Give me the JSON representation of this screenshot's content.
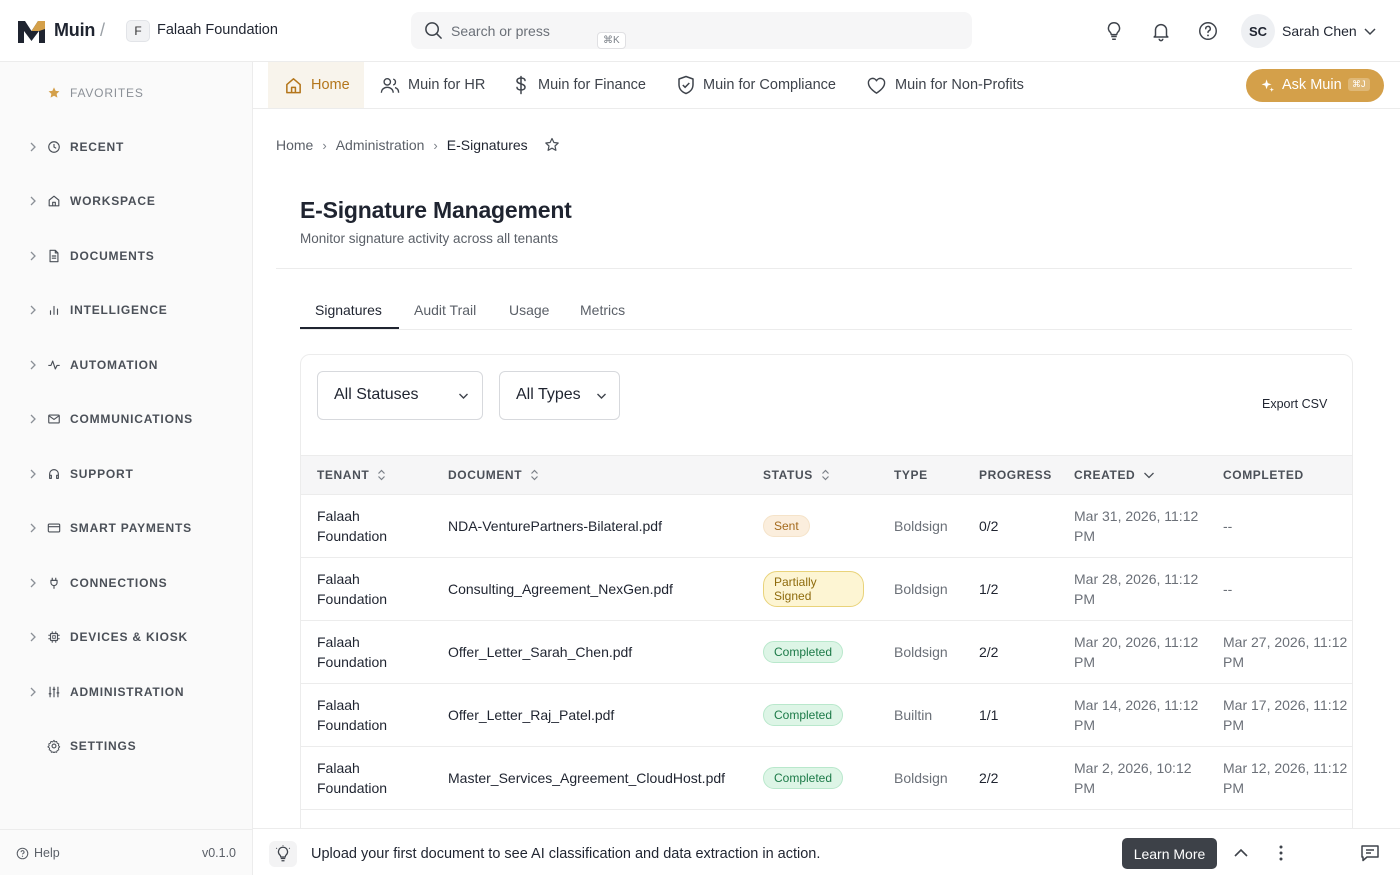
{
  "header": {
    "brand": "Muin",
    "separator": "/",
    "tenant_initial": "F",
    "tenant_name": "Falaah Foundation",
    "search_placeholder": "Search or press",
    "search_shortcut": "⌘K",
    "user_initials": "SC",
    "user_name": "Sarah Chen"
  },
  "sidebar": {
    "items": [
      {
        "label": "FAVORITES",
        "icon": "star-icon"
      },
      {
        "label": "RECENT",
        "icon": "clock-icon"
      },
      {
        "label": "WORKSPACE",
        "icon": "home-icon"
      },
      {
        "label": "DOCUMENTS",
        "icon": "document-icon"
      },
      {
        "label": "INTELLIGENCE",
        "icon": "chart-bars-icon"
      },
      {
        "label": "AUTOMATION",
        "icon": "activity-icon"
      },
      {
        "label": "COMMUNICATIONS",
        "icon": "mail-icon"
      },
      {
        "label": "SUPPORT",
        "icon": "headset-icon"
      },
      {
        "label": "SMART PAYMENTS",
        "icon": "card-icon"
      },
      {
        "label": "CONNECTIONS",
        "icon": "plug-icon"
      },
      {
        "label": "DEVICES & KIOSK",
        "icon": "chip-icon"
      },
      {
        "label": "ADMINISTRATION",
        "icon": "sliders-icon"
      },
      {
        "label": "SETTINGS",
        "icon": "gear-icon"
      }
    ],
    "help": "Help",
    "version": "v0.1.0"
  },
  "nav": {
    "tabs": [
      {
        "label": "Home",
        "icon": "home-icon"
      },
      {
        "label": "Muin for HR",
        "icon": "users-icon"
      },
      {
        "label": "Muin for Finance",
        "icon": "dollar-icon"
      },
      {
        "label": "Muin for Compliance",
        "icon": "shield-check-icon"
      },
      {
        "label": "Muin for Non-Profits",
        "icon": "heart-icon"
      }
    ],
    "ask_label": "Ask Muin",
    "ask_shortcut": "⌘J"
  },
  "breadcrumb": [
    "Home",
    "Administration",
    "E-Signatures"
  ],
  "page": {
    "title": "E-Signature Management",
    "subtitle": "Monitor signature activity across all tenants"
  },
  "tabs": [
    "Signatures",
    "Audit Trail",
    "Usage",
    "Metrics"
  ],
  "filters": {
    "status": "All Statuses",
    "type": "All Types",
    "export": "Export CSV"
  },
  "table": {
    "columns": [
      "TENANT",
      "DOCUMENT",
      "STATUS",
      "TYPE",
      "PROGRESS",
      "CREATED",
      "COMPLETED"
    ],
    "rows": [
      {
        "tenant": "Falaah Foundation",
        "document": "NDA-VenturePartners-Bilateral.pdf",
        "status": "Sent",
        "type": "Boldsign",
        "progress": "0/2",
        "created": "Mar 31, 2026, 11:12 PM",
        "completed": "--"
      },
      {
        "tenant": "Falaah Foundation",
        "document": "Consulting_Agreement_NexGen.pdf",
        "status": "Partially Signed",
        "type": "Boldsign",
        "progress": "1/2",
        "created": "Mar 28, 2026, 11:12 PM",
        "completed": "--"
      },
      {
        "tenant": "Falaah Foundation",
        "document": "Offer_Letter_Sarah_Chen.pdf",
        "status": "Completed",
        "type": "Boldsign",
        "progress": "2/2",
        "created": "Mar 20, 2026, 11:12 PM",
        "completed": "Mar 27, 2026, 11:12 PM"
      },
      {
        "tenant": "Falaah Foundation",
        "document": "Offer_Letter_Raj_Patel.pdf",
        "status": "Completed",
        "type": "Builtin",
        "progress": "1/1",
        "created": "Mar 14, 2026, 11:12 PM",
        "completed": "Mar 17, 2026, 11:12 PM"
      },
      {
        "tenant": "Falaah Foundation",
        "document": "Master_Services_Agreement_CloudHost.pdf",
        "status": "Completed",
        "type": "Boldsign",
        "progress": "2/2",
        "created": "Mar 2, 2026, 10:12 PM",
        "completed": "Mar 12, 2026, 11:12 PM"
      }
    ]
  },
  "banner": {
    "text": "Upload your first document to see AI classification and data extraction in action.",
    "learn_more": "Learn More"
  },
  "colors": {
    "accent": "#d4a04a",
    "accent_text": "#b4761b",
    "completed_bg": "#ddf5e6",
    "sent_bg": "#fbeedd",
    "partial_bg": "#fdf5d3"
  }
}
